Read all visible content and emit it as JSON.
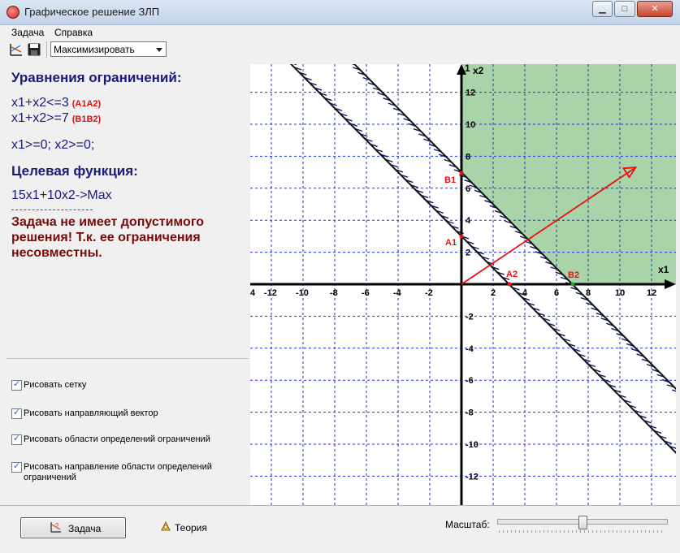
{
  "window": {
    "title": "Графическое решение ЗЛП",
    "minimize": "▁",
    "maximize": "□",
    "close": "✕"
  },
  "menu": [
    "Задача",
    "Справка"
  ],
  "toolbar": {
    "mode_value": "Максимизировать"
  },
  "panel": {
    "constraints_title": "Уравнения ограничений:",
    "constraints": [
      {
        "text": "x1+x2<=3",
        "tag": "(A1A2)"
      },
      {
        "text": "x1+x2>=7",
        "tag": "(B1B2)"
      }
    ],
    "nonneg": "x1>=0; x2>=0;",
    "goal_title": "Целевая функция:",
    "goal": "15x1+10x2->Max",
    "dashes": "-----------------------------",
    "error": "Задача не имеет допустимого решения! Т.к. ее ограничения несовместны."
  },
  "options": [
    "Рисовать сетку",
    "Рисовать направляющий вектор",
    "Рисовать области определений ограничений",
    "Рисовать направление области определений ограничений"
  ],
  "bottom": {
    "task_button": "Задача",
    "theory_button": "Теория",
    "scale_label": "Масштаб:",
    "scale_fraction": 0.5
  },
  "graph": {
    "axis_x_label": "x1",
    "axis_y_label": "x2",
    "x_ticks": [
      "4",
      "-12",
      "-10",
      "-8",
      "-6",
      "-4",
      "-2",
      "2",
      "4",
      "6",
      "8",
      "10",
      "12"
    ],
    "y_ticks_pos": [
      "12",
      "10",
      "8",
      "6",
      "4",
      "2"
    ],
    "y_ticks_neg": [
      "-2",
      "-4",
      "-6",
      "-8",
      "-10",
      "-12"
    ],
    "y_top_label": "1",
    "points": {
      "A1": "A1",
      "A2": "A2",
      "B1": "B1",
      "B2": "B2"
    },
    "colors": {
      "grid": "#1f2fd6",
      "region": "#a9d4a9",
      "vector": "#e81010",
      "hatch": "#111a66"
    }
  }
}
